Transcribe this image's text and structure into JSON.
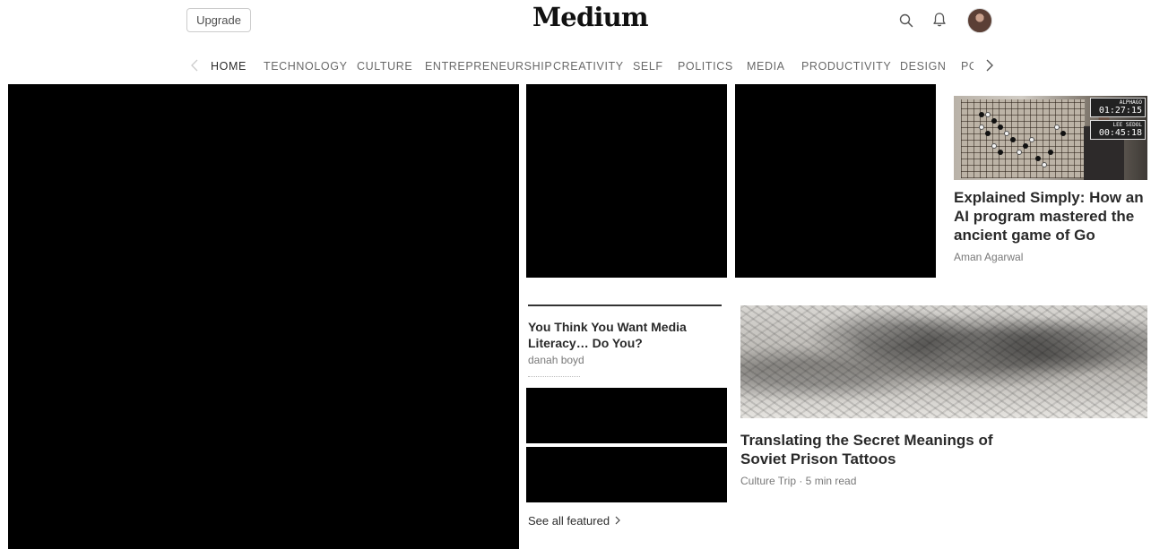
{
  "header": {
    "upgrade_label": "Upgrade",
    "logo_text": "Medium",
    "icons": [
      "search-icon",
      "bell-icon",
      "avatar"
    ]
  },
  "nav": {
    "items": [
      "HOME",
      "TECHNOLOGY",
      "CULTURE",
      "ENTREPRENEURSHIP",
      "CREATIVITY",
      "SELF",
      "POLITICS",
      "MEDIA",
      "PRODUCTIVITY",
      "DESIGN",
      "POPULAR"
    ],
    "active": "HOME"
  },
  "stories": {
    "go": {
      "title": "Explained Simply: How an AI program mastered the ancient game of Go",
      "author": "Aman Agarwal",
      "clock1_label": "ALPHAGO",
      "clock1_time": "01:27:15",
      "clock2_label": "LEE SEDOL",
      "clock2_time": "00:45:18"
    },
    "media": {
      "title": "You Think You Want Media Literacy… Do You?",
      "author": "danah boyd"
    },
    "tattoo": {
      "title": "Translating the Secret Meanings of Soviet Prison Tattoos",
      "meta": "Culture Trip · 5 min read"
    }
  },
  "see_all_label": "See all featured",
  "colors": {
    "text": "#000000d6",
    "muted": "#0000008a",
    "black_block": "#000000"
  }
}
